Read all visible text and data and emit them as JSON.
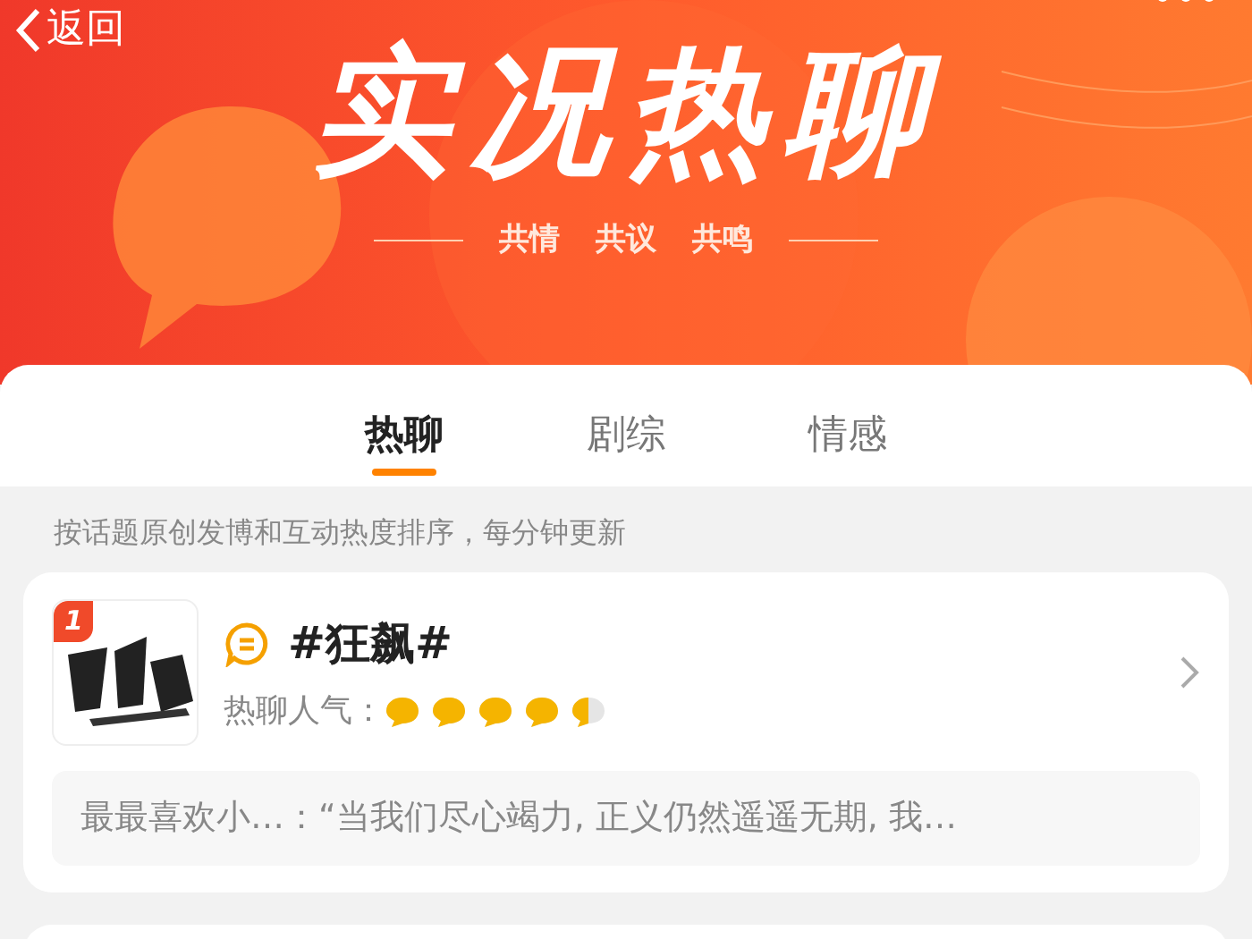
{
  "nav": {
    "back": "返回"
  },
  "banner": {
    "title": "实况热聊",
    "tagline": [
      "共情",
      "共议",
      "共鸣"
    ]
  },
  "tabs": [
    {
      "label": "热聊",
      "selected": true
    },
    {
      "label": "剧综",
      "selected": false
    },
    {
      "label": "情感",
      "selected": false
    }
  ],
  "note": "按话题原创发博和互动热度排序，每分钟更新",
  "topics": [
    {
      "rank": "1",
      "title": "#狂飙#",
      "popularity_label": "热聊人气：",
      "stars": 4.5,
      "quote": "最最喜欢小…：“当我们尽心竭力, 正义仍然遥遥无期, 我…"
    }
  ]
}
